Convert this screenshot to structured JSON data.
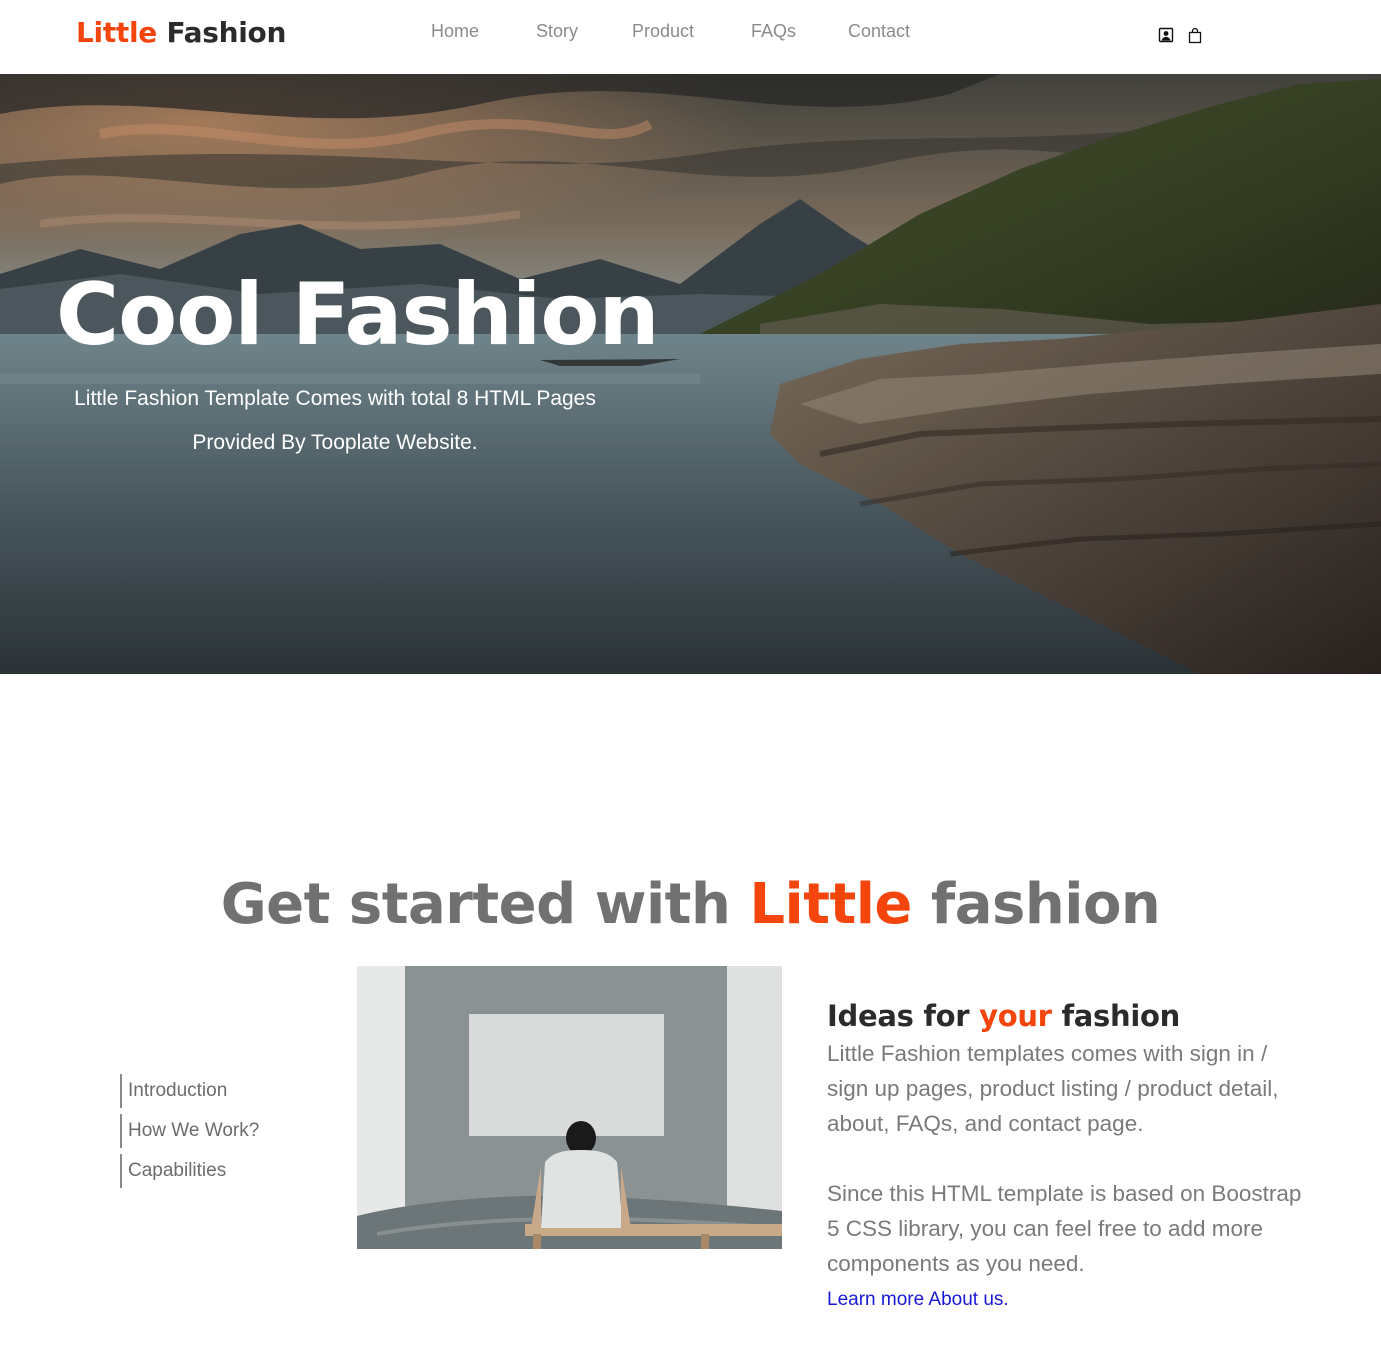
{
  "brand": {
    "part1": "Little",
    "part2": "Fashion",
    "accent_color": "#f4450d"
  },
  "nav": {
    "items": [
      {
        "label": "Home"
      },
      {
        "label": "Story"
      },
      {
        "label": "Product"
      },
      {
        "label": "FAQs"
      },
      {
        "label": "Contact"
      }
    ],
    "icons": [
      "user-icon",
      "shopping-bag-icon"
    ]
  },
  "hero": {
    "title": "Cool Fashion",
    "subtitle": "Little Fashion Template Comes with total 8 HTML Pages Provided By Tooplate Website."
  },
  "section": {
    "title_before": "Get started with",
    "title_accent": "Little",
    "title_after": "fashion",
    "tabs": [
      {
        "label": "Introduction"
      },
      {
        "label": "How We Work?"
      },
      {
        "label": "Capabilities"
      }
    ],
    "heading_before": "Ideas for",
    "heading_accent": "your",
    "heading_after": "fashion",
    "paragraph1": "Little Fashion templates comes with sign in / sign up pages, product listing / product detail, about, FAQs, and contact page.",
    "paragraph2": "Since this HTML template is based on Boostrap 5 CSS library, you can feel free to add more components as you need.",
    "link_label": "Learn more About us.",
    "link_color": "#1a1ad6"
  }
}
